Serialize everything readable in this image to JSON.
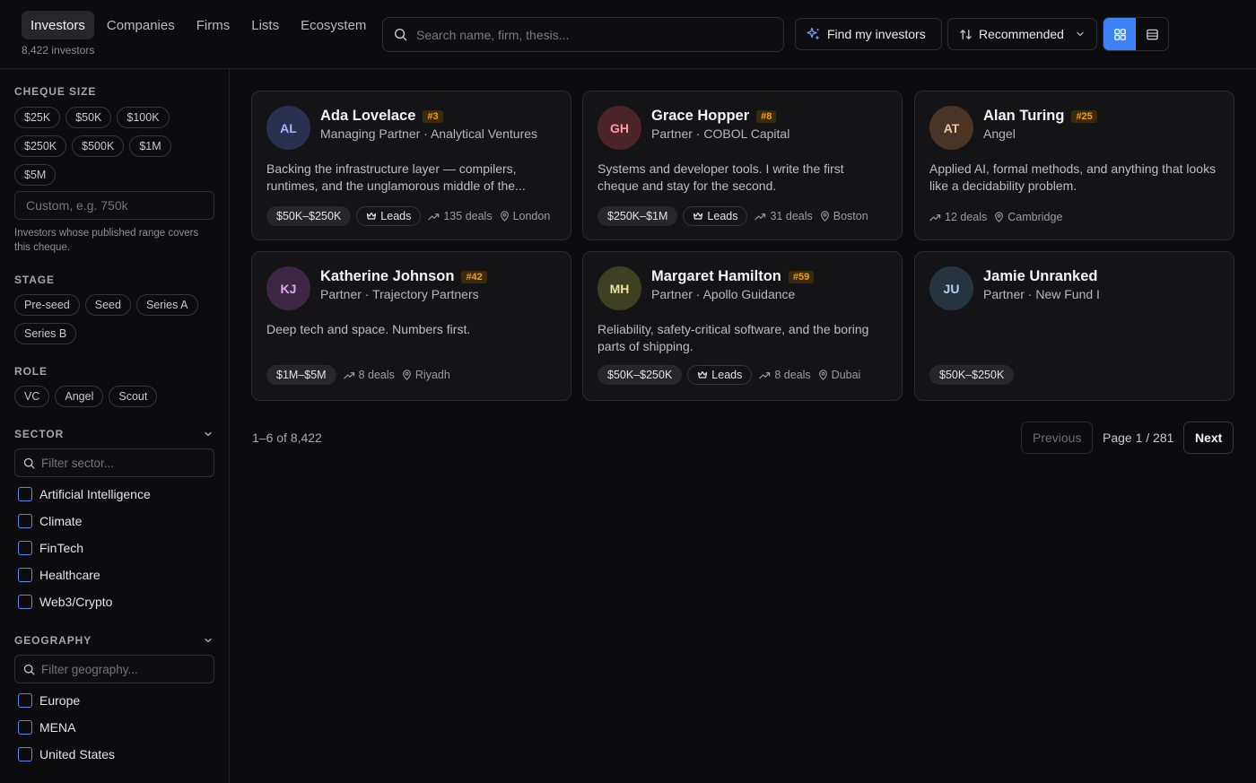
{
  "nav": {
    "tabs": [
      {
        "label": "Investors",
        "active": true
      },
      {
        "label": "Companies"
      },
      {
        "label": "Firms"
      },
      {
        "label": "Lists"
      },
      {
        "label": "Ecosystem"
      }
    ],
    "count": "8,422 investors"
  },
  "search": {
    "placeholder": "Search name, firm, thesis..."
  },
  "toolbar": {
    "find_label": "Find my investors",
    "sort_label": "Recommended",
    "view_mode": "grid"
  },
  "sidebar": {
    "cheque": {
      "title": "CHEQUE SIZE",
      "chips": [
        "$25K",
        "$50K",
        "$100K",
        "$250K",
        "$500K",
        "$1M",
        "$5M"
      ],
      "custom_placeholder": "Custom, e.g. 750k",
      "help": "Investors whose published range covers this cheque."
    },
    "stage": {
      "title": "STAGE",
      "chips": [
        "Pre-seed",
        "Seed",
        "Series A",
        "Series B"
      ]
    },
    "role": {
      "title": "ROLE",
      "chips": [
        "VC",
        "Angel",
        "Scout"
      ]
    },
    "sector": {
      "title": "SECTOR",
      "placeholder": "Filter sector...",
      "items": [
        "Artificial Intelligence",
        "Climate",
        "FinTech",
        "Healthcare",
        "Web3/Crypto"
      ]
    },
    "geography": {
      "title": "GEOGRAPHY",
      "placeholder": "Filter geography...",
      "items": [
        "Europe",
        "MENA",
        "United States"
      ]
    }
  },
  "cards": [
    {
      "initials": "AL",
      "name": "Ada Lovelace",
      "rank": "#3",
      "role": "Managing Partner · Analytical Ventures",
      "thesis": "Backing the infrastructure layer — compilers, runtimes, and the unglamorous middle of the...",
      "range": "$50K–$250K",
      "leads": "Leads",
      "deals": "135 deals",
      "location": "London",
      "avatar_bg": "#2b3050",
      "avatar_fg": "#a9b6ff"
    },
    {
      "initials": "GH",
      "name": "Grace Hopper",
      "rank": "#8",
      "role": "Partner · COBOL Capital",
      "thesis": "Systems and developer tools. I write the first cheque and stay for the second.",
      "range": "$250K–$1M",
      "leads": "Leads",
      "deals": "31 deals",
      "location": "Boston",
      "avatar_bg": "#4a2428",
      "avatar_fg": "#ff9b9b"
    },
    {
      "initials": "AT",
      "name": "Alan Turing",
      "rank": "#25",
      "role": "Angel",
      "thesis": "Applied AI, formal methods, and anything that looks like a decidability problem.",
      "range": "",
      "leads": "",
      "deals": "12 deals",
      "location": "Cambridge",
      "avatar_bg": "#4a3426",
      "avatar_fg": "#f3c79b"
    },
    {
      "initials": "KJ",
      "name": "Katherine Johnson",
      "rank": "#42",
      "role": "Partner · Trajectory Partners",
      "thesis": "Deep tech and space. Numbers first.",
      "range": "$1M–$5M",
      "leads": "",
      "deals": "8 deals",
      "location": "Riyadh",
      "avatar_bg": "#3d2744",
      "avatar_fg": "#e3a6f3"
    },
    {
      "initials": "MH",
      "name": "Margaret Hamilton",
      "rank": "#59",
      "role": "Partner · Apollo Guidance",
      "thesis": "Reliability, safety-critical software, and the boring parts of shipping.",
      "range": "$50K–$250K",
      "leads": "Leads",
      "deals": "8 deals",
      "location": "Dubai",
      "avatar_bg": "#3f3f22",
      "avatar_fg": "#e7e39a"
    },
    {
      "initials": "JU",
      "name": "Jamie Unranked",
      "rank": "",
      "role": "Partner · New Fund I",
      "thesis": "",
      "range": "$50K–$250K",
      "leads": "",
      "deals": "",
      "location": "",
      "avatar_bg": "#26343f",
      "avatar_fg": "#a9d3f3"
    }
  ],
  "pagination": {
    "range": "1–6 of 8,422",
    "previous": "Previous",
    "page": "Page 1 / 281",
    "next": "Next"
  }
}
